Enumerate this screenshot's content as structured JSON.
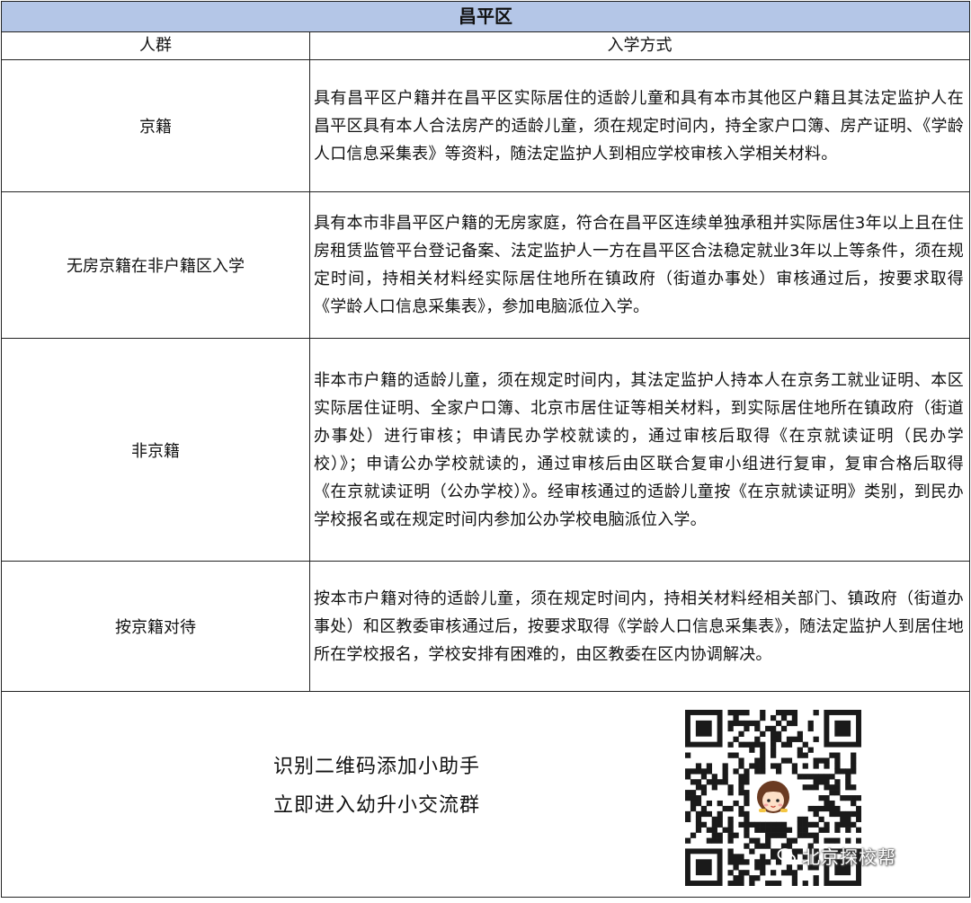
{
  "table": {
    "title": "昌平区",
    "headers": {
      "group": "人群",
      "method": "入学方式"
    },
    "rows": [
      {
        "group": "京籍",
        "method": "具有昌平区户籍并在昌平区实际居住的适龄儿童和具有本市其他区户籍且其法定监护人在昌平区具有本人合法房产的适龄儿童，须在规定时间内，持全家户口簿、房产证明、《学龄人口信息采集表》等资料，随法定监护人到相应学校审核入学相关材料。"
      },
      {
        "group": "无房京籍在非户籍区入学",
        "method": "具有本市非昌平区户籍的无房家庭，符合在昌平区连续单独承租并实际居住3年以上且在住房租赁监管平台登记备案、法定监护人一方在昌平区合法稳定就业3年以上等条件，须在规定时间，持相关材料经实际居住地所在镇政府（街道办事处）审核通过后，按要求取得《学龄人口信息采集表》，参加电脑派位入学。"
      },
      {
        "group": "非京籍",
        "method": "非本市户籍的适龄儿童，须在规定时间内，其法定监护人持本人在京务工就业证明、本区实际居住证明、全家户口簿、北京市居住证等相关材料，到实际居住地所在镇政府（街道办事处）进行审核；申请民办学校就读的，通过审核后取得《在京就读证明（民办学校）》；申请公办学校就读的，通过审核后由区联合复审小组进行复审，复审合格后取得《在京就读证明（公办学校）》。经审核通过的适龄儿童按《在京就读证明》类别，到民办学校报名或在规定时间内参加公办学校电脑派位入学。"
      },
      {
        "group": "按京籍对待",
        "method": "按本市户籍对待的适龄儿童，须在规定时间内，持相关材料经相关部门、镇政府（街道办事处）和区教委审核通过后，按要求取得《学龄人口信息采集表》，随法定监护人到居住地所在学校报名，学校安排有困难的，由区教委在区内协调解决。"
      }
    ]
  },
  "footer": {
    "line1": "识别二维码添加小助手",
    "line2": "立即进入幼升小交流群",
    "watermark": "北京探校帮",
    "qr_icon": "qr-code-icon",
    "avatar_icon": "cartoon-girl-avatar-icon",
    "wechat_icon": "wechat-icon"
  }
}
